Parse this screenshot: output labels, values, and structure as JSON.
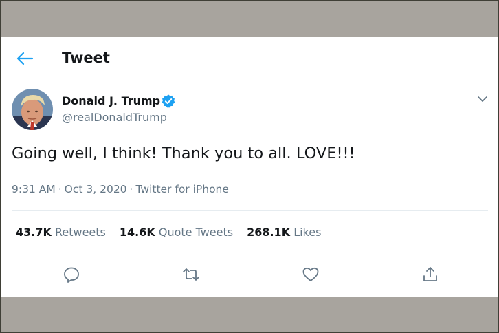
{
  "header": {
    "title": "Tweet",
    "back_icon": "arrow-left-icon"
  },
  "author": {
    "display_name": "Donald J. Trump",
    "handle": "@realDonaldTrump",
    "verified": true
  },
  "tweet": {
    "text": "Going well, I think! Thank you to all. LOVE!!!",
    "time": "9:31 AM",
    "date": "Oct 3, 2020",
    "source": "Twitter for iPhone",
    "separator": "·"
  },
  "stats": {
    "retweets": {
      "count": "43.7K",
      "label": "Retweets"
    },
    "quote_tweets": {
      "count": "14.6K",
      "label": "Quote Tweets"
    },
    "likes": {
      "count": "268.1K",
      "label": "Likes"
    }
  },
  "actions": [
    "reply-icon",
    "retweet-icon",
    "like-icon",
    "share-icon"
  ],
  "colors": {
    "accent": "#1da1f2",
    "text": "#14171a",
    "secondary": "#657786",
    "background": "#a8a49e"
  }
}
